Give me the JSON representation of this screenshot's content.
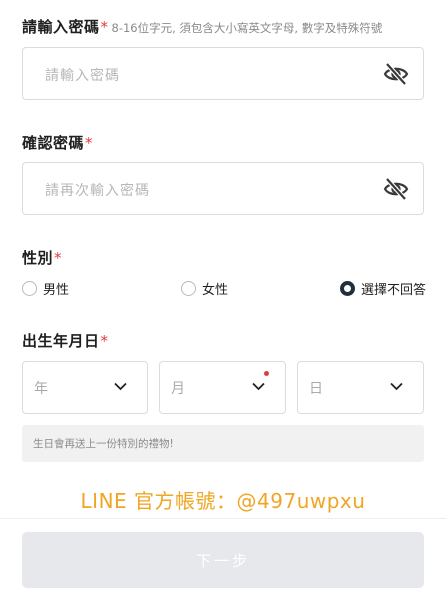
{
  "password": {
    "label": "請輸入密碼",
    "required_mark": "*",
    "hint": "8-16位字元, 須包含大小寫英文字母, 數字及特殊符號",
    "placeholder": "請輸入密碼",
    "toggle_icon": "eye-slash-icon"
  },
  "confirm_password": {
    "label": "確認密碼",
    "required_mark": "*",
    "placeholder": "請再次輸入密碼",
    "toggle_icon": "eye-slash-icon"
  },
  "gender": {
    "label": "性別",
    "required_mark": "*",
    "options": [
      {
        "label": "男性",
        "selected": false
      },
      {
        "label": "女性",
        "selected": false
      },
      {
        "label": "選擇不回答",
        "selected": true
      }
    ]
  },
  "birthday": {
    "label": "出生年月日",
    "required_mark": "*",
    "year_placeholder": "年",
    "month_placeholder": "月",
    "day_placeholder": "日",
    "note": "生日會再送上一份特別的禮物!"
  },
  "promo": {
    "text": "LINE 官方帳號：@497uwpxu"
  },
  "next_button": {
    "label": "下一步"
  },
  "colors": {
    "required": "#e03c3c",
    "promo": "#f0a623",
    "radio_selected": "#1f2f3e",
    "button_disabled": "#e6e8eb"
  }
}
